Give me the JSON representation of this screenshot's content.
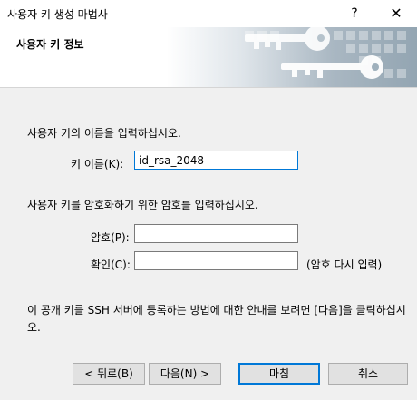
{
  "window": {
    "title": "사용자 키 생성 마법사",
    "help_label": "?",
    "close_label": "✕"
  },
  "header": {
    "title": "사용자 키 정보",
    "art_icon": "keys-graphic-icon"
  },
  "form": {
    "intro_name": "사용자 키의 이름을 입력하십시오.",
    "key_name_label": "키 이름(K):",
    "key_name_value": "id_rsa_2048",
    "intro_password": "사용자 키를 암호화하기 위한 암호를 입력하십시오.",
    "password_label": "암호(P):",
    "password_value": "",
    "confirm_label": "확인(C):",
    "confirm_value": "",
    "confirm_hint": "(암호 다시 입력)",
    "info_text": "이 공개 키를 SSH 서버에 등록하는 방법에 대한 안내를 보려면 [다음]을 클릭하십시오."
  },
  "buttons": {
    "back": "< 뒤로(B)",
    "next": "다음(N) >",
    "finish": "마침",
    "cancel": "취소"
  },
  "colors": {
    "focus_border": "#0078d7",
    "header_gradient_end": "#93a5b2"
  }
}
